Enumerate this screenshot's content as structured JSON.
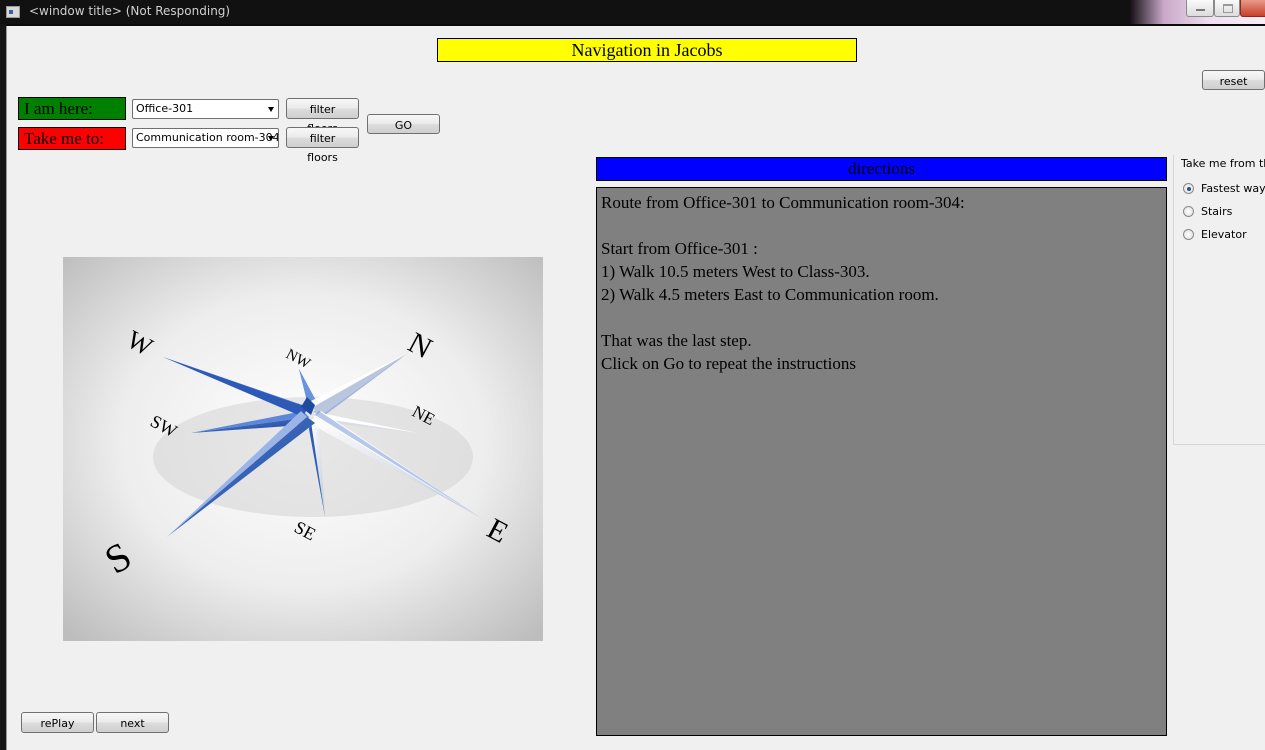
{
  "window": {
    "title": "<window title> (Not Responding)"
  },
  "header": {
    "title": "Navigation in Jacobs",
    "bg_color": "#ffff00"
  },
  "controls": {
    "here_label": "I am here:",
    "here_label_color": "#008000",
    "to_label": "Take me to:",
    "to_label_color": "#ff0000",
    "from_select": {
      "value": "Office-301"
    },
    "to_select": {
      "value": "Communication room-304"
    },
    "filter_floors_label": "filter floors",
    "go_label": "GO",
    "reset_label": "reset"
  },
  "directions": {
    "header": "directions",
    "header_color": "#0000ff",
    "text_color_bg": "#808080",
    "lines": [
      "Route from Office-301 to Communication room-304:",
      "",
      "Start from Office-301 :",
      "1) Walk 10.5 meters West to Class-303.",
      "2) Walk 4.5 meters East to Communication room.",
      "",
      "That was the last step.",
      "Click on Go to repeat the instructions"
    ]
  },
  "route_options": {
    "label": "Take me from the",
    "options": [
      "Fastest way",
      "Stairs",
      "Elevator"
    ],
    "selected": "Fastest way"
  },
  "compass": {
    "labels": [
      "N",
      "NE",
      "E",
      "SE",
      "S",
      "SW",
      "W",
      "NW"
    ]
  },
  "playback": {
    "replay_label": "rePlay",
    "next_label": "next"
  }
}
